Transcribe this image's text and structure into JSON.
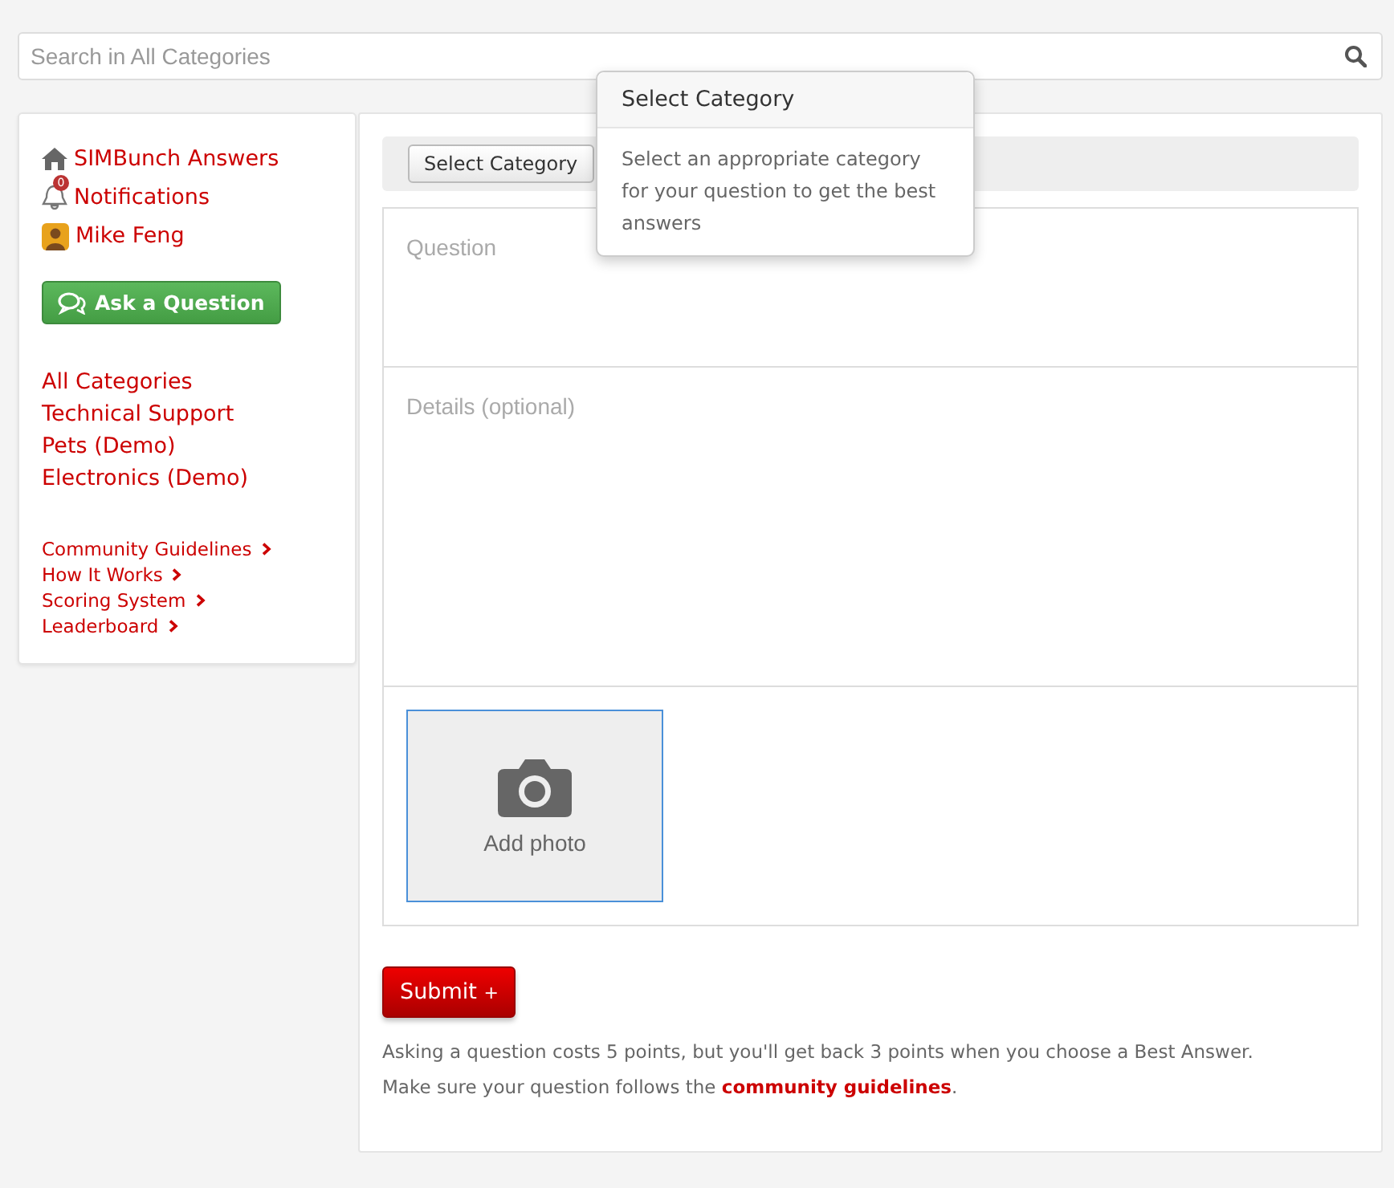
{
  "search": {
    "placeholder": "Search in All Categories"
  },
  "sidebar": {
    "nav": [
      {
        "kind": "home",
        "label": "SIMBunch Answers"
      },
      {
        "kind": "bell",
        "label": "Notifications",
        "badge": "0"
      },
      {
        "kind": "avatar",
        "label": "Mike Feng"
      }
    ],
    "ask_button": "Ask a Question",
    "categories": [
      "All Categories",
      "Technical Support",
      "Pets (Demo)",
      "Electronics (Demo)"
    ],
    "links": [
      "Community Guidelines",
      "How It Works",
      "Scoring System",
      "Leaderboard"
    ]
  },
  "form": {
    "category_button": "Select Category",
    "popover": {
      "title": "Select Category",
      "body": "Select an appropriate category for your question to get the best answers"
    },
    "question": {
      "placeholder": "Question"
    },
    "details": {
      "placeholder": "Details (optional)"
    },
    "photo_label": "Add photo",
    "submit": {
      "label": "Submit",
      "suffix": "+"
    },
    "notes": [
      "Asking a question costs 5 points, but you'll get back 3 points when you choose a Best Answer.",
      "Make sure your question follows the "
    ],
    "guidelines_link": "community guidelines",
    "end": "."
  }
}
